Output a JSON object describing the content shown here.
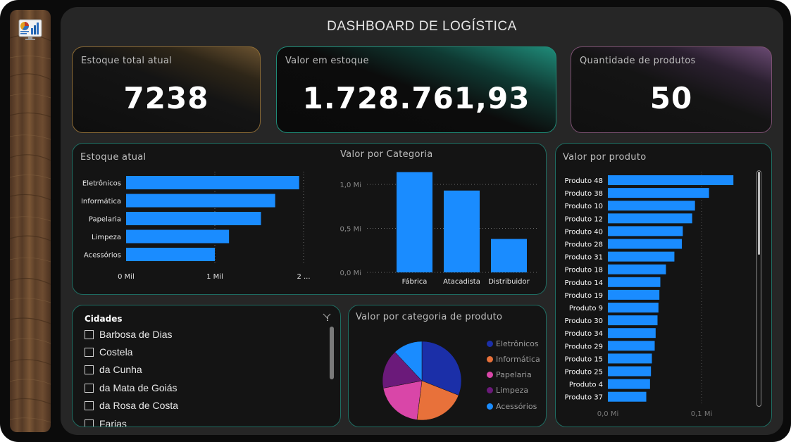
{
  "dashboard": {
    "title": "DASHBOARD DE LOGÍSTICA"
  },
  "sidebar": {
    "logo_icon": "dashboard-report-icon"
  },
  "kpis": [
    {
      "label": "Estoque total atual",
      "value": "7238",
      "accent": "#8a6a35"
    },
    {
      "label": "Valor em estoque",
      "value": "1.728.761,93",
      "accent": "#1f8c78"
    },
    {
      "label": "Quantidade de produtos",
      "value": "50",
      "accent": "#7a4f70"
    }
  ],
  "colors": {
    "bar": "#1a8cff",
    "panel_border": "#1f6d62",
    "background": "#262626"
  },
  "chart_data": [
    {
      "type": "bar",
      "orientation": "horizontal",
      "title": "Estoque atual",
      "categories": [
        "Eletrônicos",
        "Informática",
        "Papelaria",
        "Limpeza",
        "Acessórios"
      ],
      "values": [
        1950,
        1680,
        1520,
        1160,
        1000
      ],
      "xlim": [
        0,
        2000
      ],
      "xticks": [
        0,
        1000,
        2000
      ],
      "xtick_labels": [
        "0 Mil",
        "1 Mil",
        "2 ..."
      ],
      "grid": true
    },
    {
      "type": "bar",
      "title": "Valor por Categoria",
      "categories": [
        "Fábrica",
        "Atacadista",
        "Distribuidor"
      ],
      "values": [
        1.14,
        0.93,
        0.38
      ],
      "ylim": [
        0,
        1.0
      ],
      "yticks": [
        0,
        0.5,
        1.0
      ],
      "ytick_labels": [
        "0,0 Mi",
        "0,5 Mi",
        "1,0 Mi"
      ],
      "grid": true
    },
    {
      "type": "bar",
      "orientation": "horizontal",
      "title": "Valor por produto",
      "categories": [
        "Produto 48",
        "Produto 38",
        "Produto 10",
        "Produto 12",
        "Produto 40",
        "Produto 28",
        "Produto 31",
        "Produto 18",
        "Produto 14",
        "Produto 19",
        "Produto 9",
        "Produto 30",
        "Produto 34",
        "Produto 29",
        "Produto 15",
        "Produto 25",
        "Produto 4",
        "Produto 37"
      ],
      "values": [
        0.134,
        0.108,
        0.093,
        0.09,
        0.08,
        0.079,
        0.071,
        0.062,
        0.056,
        0.055,
        0.054,
        0.053,
        0.051,
        0.05,
        0.047,
        0.046,
        0.045,
        0.041
      ],
      "xlim": [
        0,
        0.1
      ],
      "xticks": [
        0,
        0.1
      ],
      "xtick_labels": [
        "0,0 Mi",
        "0,1 Mi"
      ],
      "grid": true
    },
    {
      "type": "pie",
      "title": "Valor por categoria de produto",
      "categories": [
        "Eletrônicos",
        "Informática",
        "Papelaria",
        "Limpeza",
        "Acessórios"
      ],
      "values": [
        31,
        21,
        20,
        16,
        12
      ],
      "colors": [
        "#1b2fa8",
        "#e8713a",
        "#d946a8",
        "#6b1a7a",
        "#1a8cff"
      ],
      "legend": "right"
    }
  ],
  "cities": {
    "title": "Cidades",
    "items": [
      "Barbosa de Dias",
      "Costela",
      "da Cunha",
      "da Mata de Goiás",
      "da Rosa de Costa",
      "Farias"
    ]
  }
}
